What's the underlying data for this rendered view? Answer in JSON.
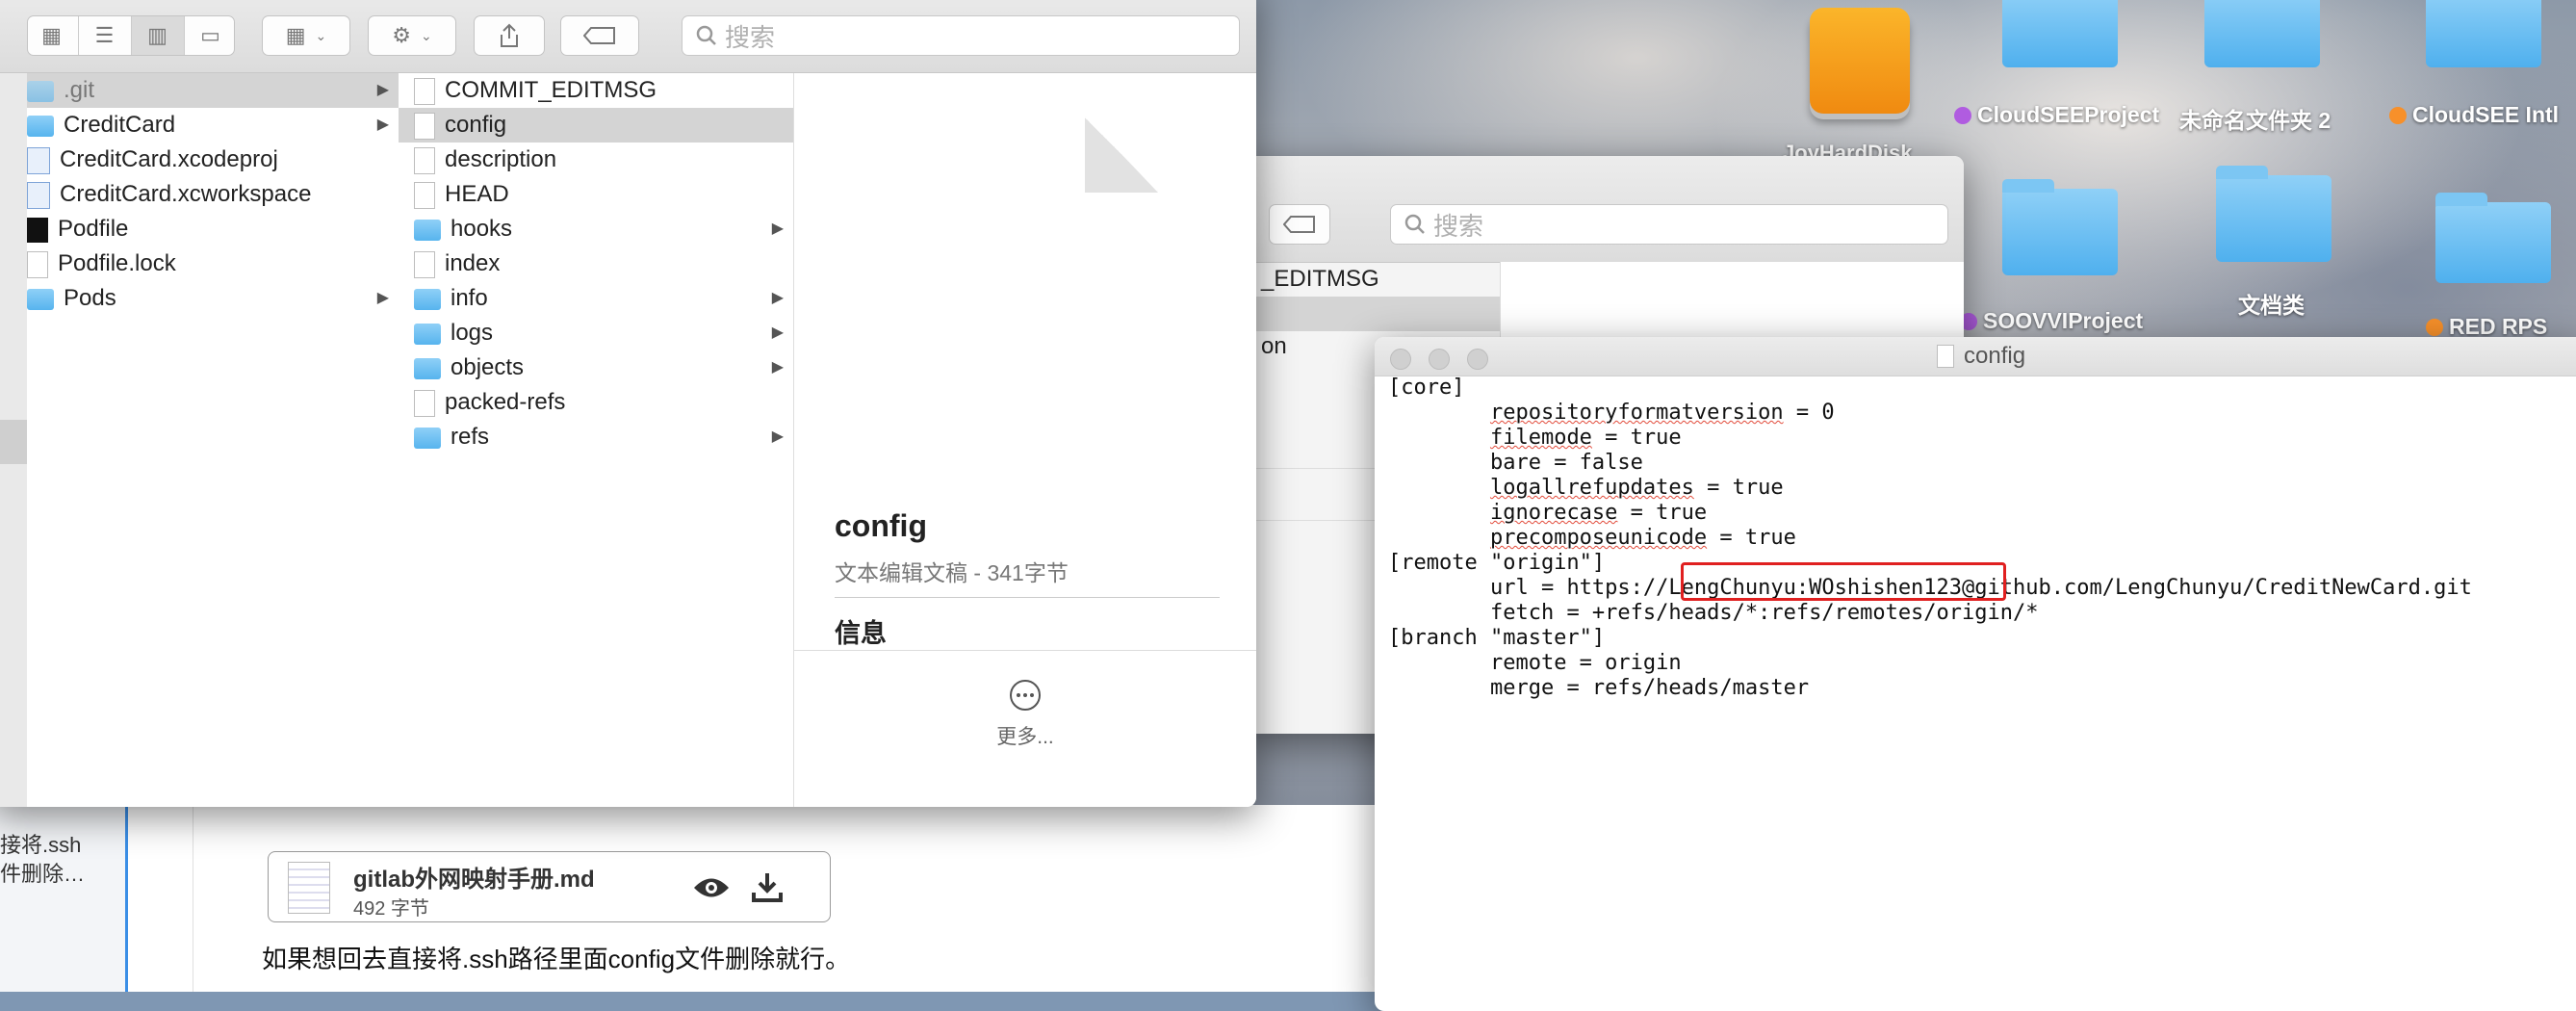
{
  "desktop": {
    "icons": [
      {
        "label": "JoyHardDisk",
        "type": "disk"
      },
      {
        "label": "CloudSEEProject",
        "type": "folder",
        "tag_color": "#b05ce0"
      },
      {
        "label": "未命名文件夹 2",
        "type": "folder"
      },
      {
        "label": "CloudSEE Intl",
        "type": "folder",
        "tag_color": "#f7902a"
      },
      {
        "label": "SOOVVIProject",
        "type": "folder",
        "tag_color": "#b05ce0"
      },
      {
        "label": "文档类",
        "type": "folder"
      },
      {
        "label": "RED RPS",
        "type": "folder",
        "tag_color": "#f7902a"
      }
    ]
  },
  "finder": {
    "search_placeholder": "搜索",
    "sidebar": [
      "",
      ""
    ],
    "column1": [
      {
        "name": ".git",
        "icon": "folder-icon",
        "selected": true,
        "arrow": true
      },
      {
        "name": "CreditCard",
        "icon": "folder-icon",
        "arrow": true
      },
      {
        "name": "CreditCard.xcodeproj",
        "icon": "xcodeproj-icon"
      },
      {
        "name": "CreditCard.xcworkspace",
        "icon": "xcworkspace-icon"
      },
      {
        "name": "Podfile",
        "icon": "terminal-file-icon"
      },
      {
        "name": "Podfile.lock",
        "icon": "text-file-icon"
      },
      {
        "name": "Pods",
        "icon": "folder-icon",
        "arrow": true
      }
    ],
    "column2": [
      {
        "name": "COMMIT_EDITMSG",
        "icon": "document-icon"
      },
      {
        "name": "config",
        "icon": "document-icon",
        "selected": true
      },
      {
        "name": "description",
        "icon": "document-icon"
      },
      {
        "name": "HEAD",
        "icon": "document-icon"
      },
      {
        "name": "hooks",
        "icon": "folder-icon",
        "arrow": true
      },
      {
        "name": "index",
        "icon": "document-icon"
      },
      {
        "name": "info",
        "icon": "folder-icon",
        "arrow": true
      },
      {
        "name": "logs",
        "icon": "folder-icon",
        "arrow": true
      },
      {
        "name": "objects",
        "icon": "folder-icon",
        "arrow": true
      },
      {
        "name": "packed-refs",
        "icon": "document-icon"
      },
      {
        "name": "refs",
        "icon": "folder-icon",
        "arrow": true
      }
    ],
    "preview": {
      "filename": "config",
      "kind": "文本编辑文稿 - 341字节",
      "info_heading": "信息",
      "more_label": "更多..."
    }
  },
  "background_finder": {
    "search_placeholder": "搜索",
    "rows": [
      "_EDITMSG",
      "on"
    ]
  },
  "textedit": {
    "title": "config",
    "lines": [
      "[core]",
      "\trepositoryformatversion = 0",
      "\tfilemode = true",
      "\tbare = false",
      "\tlogallrefupdates = true",
      "\tignorecase = true",
      "\tprecomposeunicode = true",
      "[remote \"origin\"]",
      "\turl = https://LengChunyu:WOshishen123@github.com/LengChunyu/CreditNewCard.git",
      "\tfetch = +refs/heads/*:refs/remotes/origin/*",
      "[branch \"master\"]",
      "\tremote = origin",
      "\tmerge = refs/heads/master"
    ],
    "highlight_color": "#e02020"
  },
  "webpage": {
    "side_snippet_1": "接将.ssh",
    "side_snippet_2": "件删除…",
    "attachment": {
      "name": "gitlab外网映射手册.md",
      "size": "492 字节"
    },
    "paragraph": "如果想回去直接将.ssh路径里面config文件删除就行。"
  }
}
